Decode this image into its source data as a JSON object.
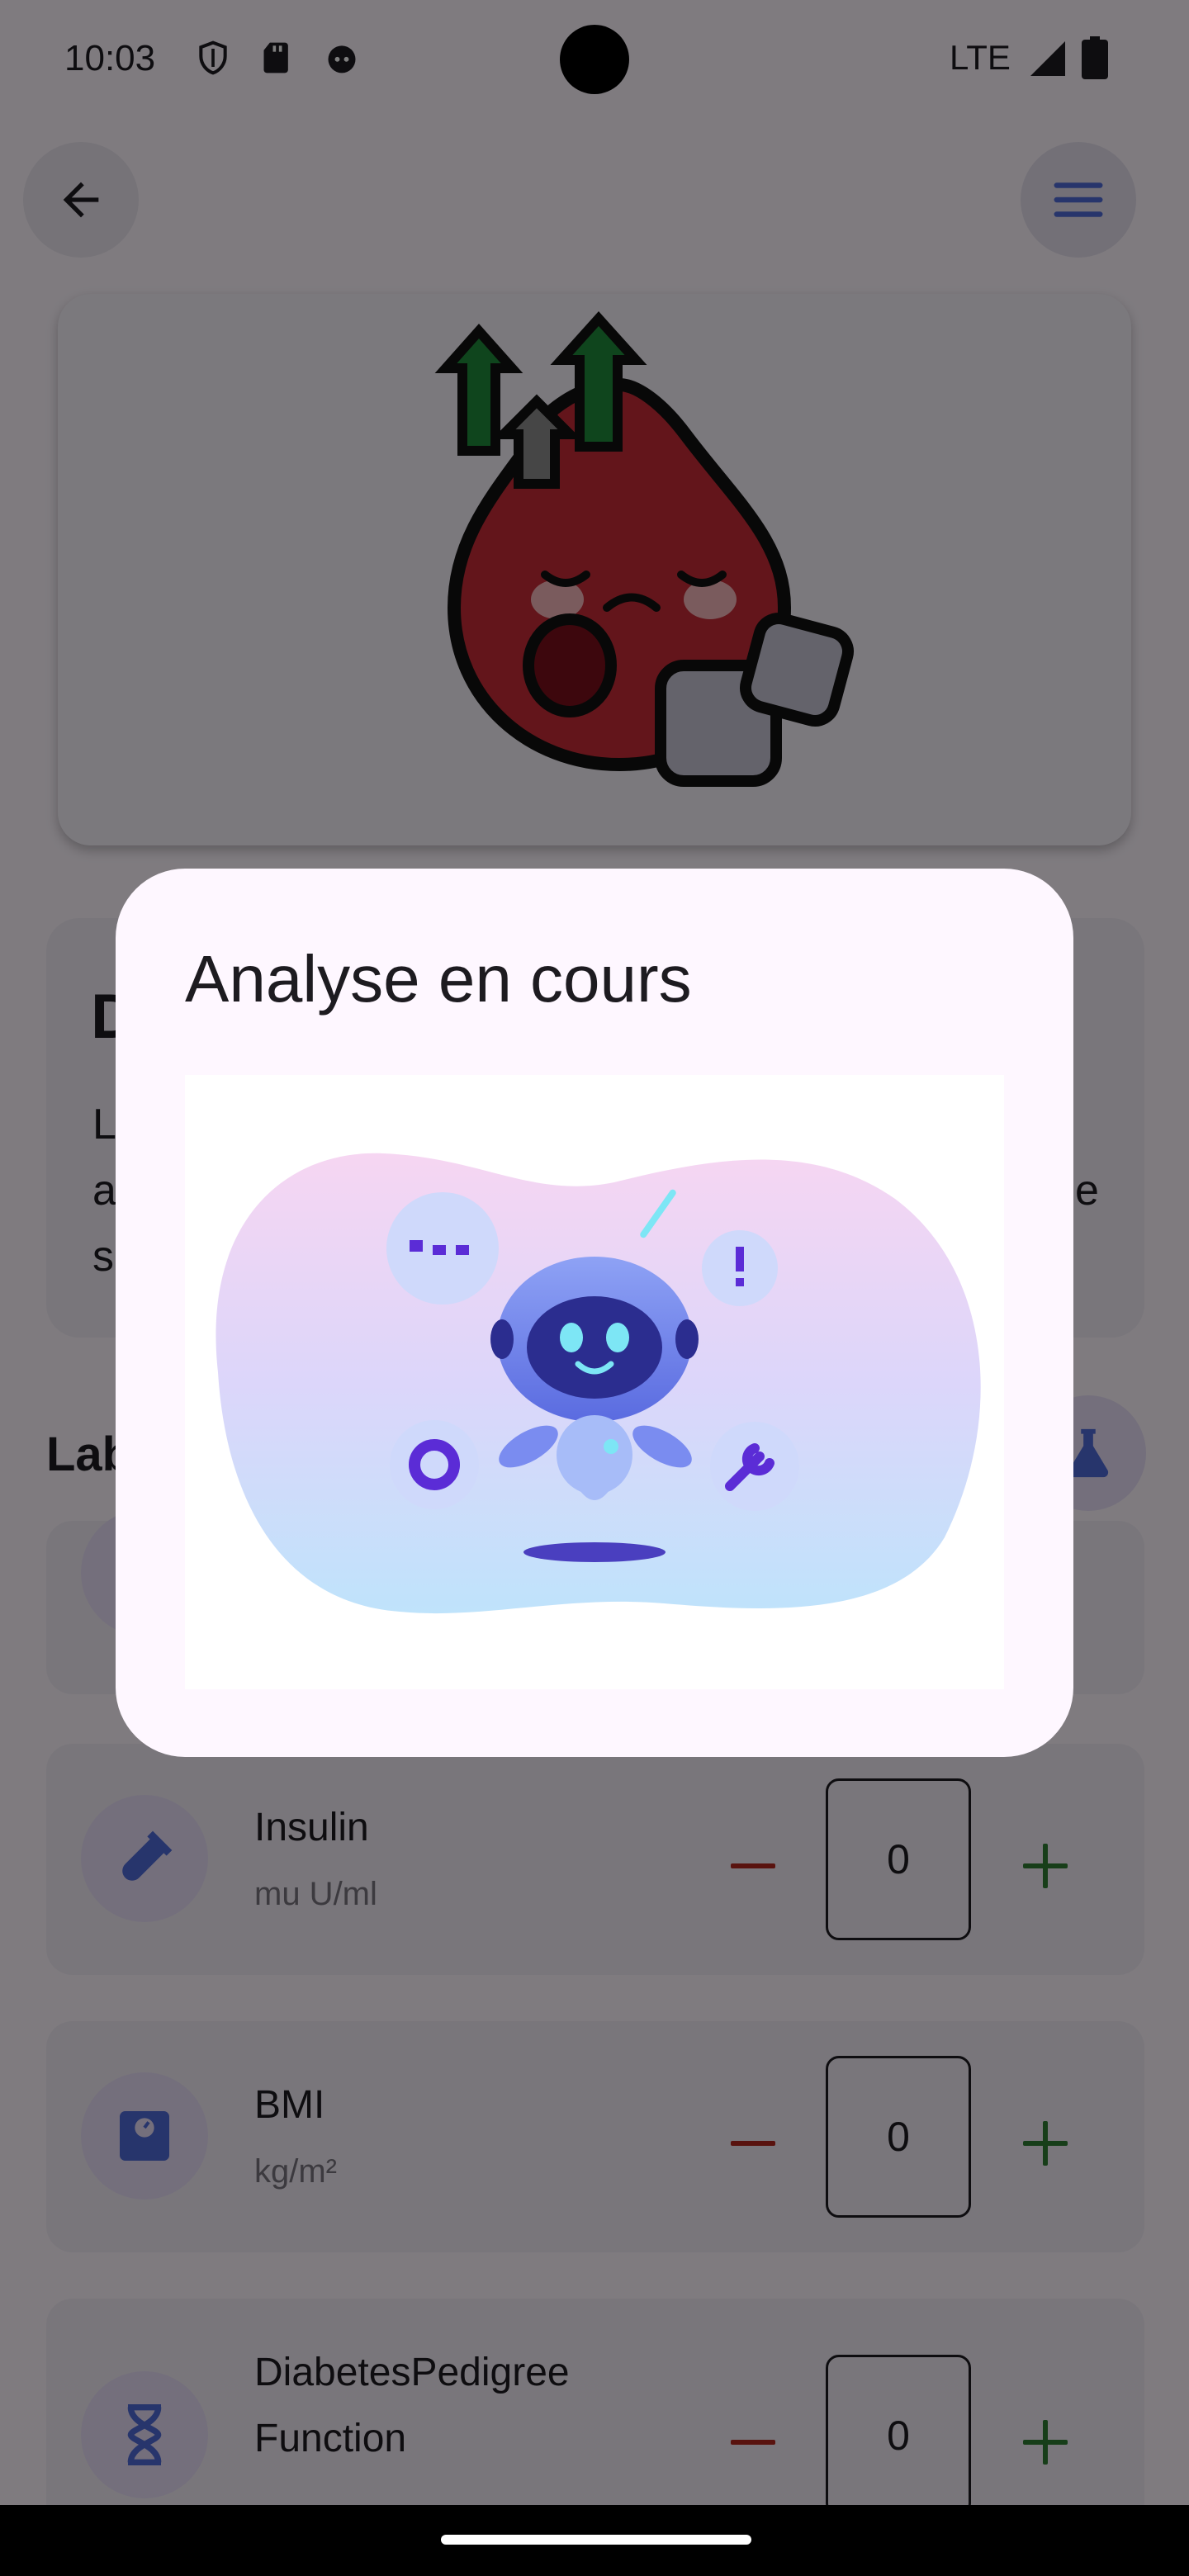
{
  "status_bar": {
    "time": "10:03",
    "network": "LTE",
    "icons": [
      "shield-icon",
      "sd-card-icon",
      "android-head-icon",
      "signal-icon",
      "battery-icon"
    ]
  },
  "app_bar": {
    "back_icon": "arrow-back-icon",
    "menu_icon": "menu-icon"
  },
  "hero": {
    "image": "blood-drop-high-sugar-illustration"
  },
  "info_card": {
    "title_fragment": "D",
    "text_fragments": [
      "L",
      "a",
      "s",
      "e"
    ]
  },
  "section": {
    "title_fragment": "Lab",
    "icon": "flask-icon"
  },
  "fields": [
    {
      "label": "Insulin",
      "unit": "mu U/ml",
      "value": "0",
      "icon": "test-tube-icon"
    },
    {
      "label": "BMI",
      "unit": "kg/m²",
      "value": "0",
      "icon": "scale-icon"
    },
    {
      "label": "DiabetesPedigree\nFunction",
      "unit": "",
      "value": "0",
      "icon": "dna-icon"
    }
  ],
  "dialog": {
    "title": "Analyse en cours",
    "illustration": "ai-robot-analysis-illustration"
  },
  "colors": {
    "primary": "#4f6bd8",
    "minus": "#b3261e",
    "plus": "#2e7d32",
    "surface": "#fef7ff"
  }
}
